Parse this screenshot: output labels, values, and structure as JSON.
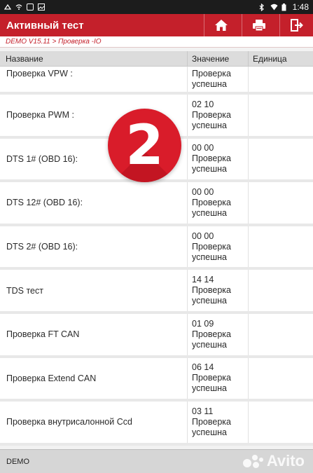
{
  "status_bar": {
    "time": "1:48"
  },
  "app_bar": {
    "title": "Активный тест",
    "buttons": [
      {
        "icon": "home-icon"
      },
      {
        "icon": "print-icon"
      },
      {
        "icon": "exit-icon"
      }
    ]
  },
  "breadcrumb": "DEMO V15.11 > Проверка -IO",
  "table": {
    "columns": [
      "Название",
      "Значение",
      "Единица"
    ],
    "rows": [
      {
        "name": "Проверка VPW :",
        "value_lines": [
          "Проверка",
          "успешна"
        ],
        "unit": ""
      },
      {
        "name": "Проверка PWM :",
        "value_lines": [
          "02 10",
          "Проверка",
          "успешна"
        ],
        "unit": ""
      },
      {
        "name": "DTS 1# (OBD 16):",
        "value_lines": [
          "00 00",
          "Проверка",
          "успешна"
        ],
        "unit": ""
      },
      {
        "name": "DTS 12# (OBD 16):",
        "value_lines": [
          "00 00",
          "Проверка",
          "успешна"
        ],
        "unit": ""
      },
      {
        "name": "DTS 2# (OBD 16):",
        "value_lines": [
          "00 00",
          "Проверка",
          "успешна"
        ],
        "unit": ""
      },
      {
        "name": "TDS тест",
        "value_lines": [
          "14 14",
          "Проверка",
          "успешна"
        ],
        "unit": ""
      },
      {
        "name": "Проверка FT CAN",
        "value_lines": [
          "01 09",
          "Проверка",
          "успешна"
        ],
        "unit": ""
      },
      {
        "name": "Проверка Extend CAN",
        "value_lines": [
          "06 14",
          "Проверка",
          "успешна"
        ],
        "unit": ""
      },
      {
        "name": "Проверка внутрисалонной Ccd",
        "value_lines": [
          "03 11",
          "Проверка",
          "успешна"
        ],
        "unit": ""
      }
    ]
  },
  "badge": {
    "number": "2",
    "color": "#d91c2a"
  },
  "footer": {
    "label": "DEMO"
  },
  "watermark": {
    "text": "Avito"
  },
  "colors": {
    "accent": "#c4202b"
  }
}
